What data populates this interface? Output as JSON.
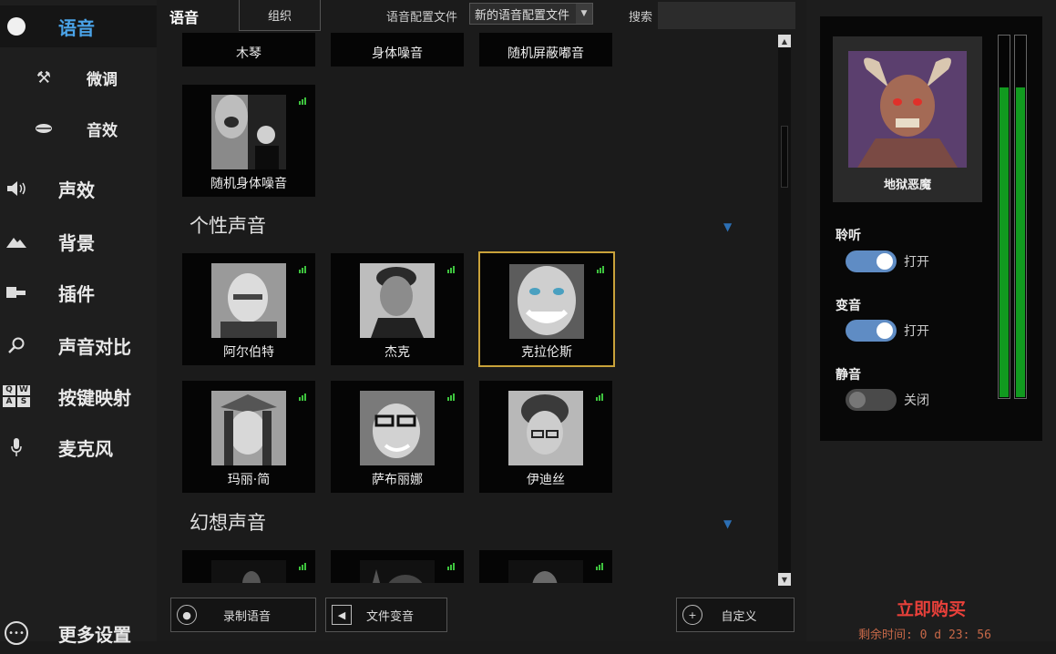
{
  "sidebar": {
    "items": [
      {
        "label": "语音",
        "icon": "logo-icon"
      },
      {
        "label": "微调",
        "icon": "tools-icon"
      },
      {
        "label": "音效",
        "icon": "lips-icon"
      },
      {
        "label": "声效",
        "icon": "speaker-icon"
      },
      {
        "label": "背景",
        "icon": "mountain-icon"
      },
      {
        "label": "插件",
        "icon": "plugin-icon"
      },
      {
        "label": "声音对比",
        "icon": "magnifier-icon"
      },
      {
        "label": "按键映射",
        "icon": "keyboard-icon"
      },
      {
        "label": "麦克风",
        "icon": "microphone-icon"
      },
      {
        "label": "更多设置",
        "icon": "more-icon"
      }
    ],
    "keyboard_keys": [
      "Q",
      "W",
      "A",
      "S"
    ]
  },
  "topbar": {
    "title": "语音",
    "org_button": "组织",
    "profile_label": "语音配置文件",
    "profile_value": "新的语音配置文件",
    "search_label": "搜索",
    "search_value": ""
  },
  "sections": [
    {
      "title": "",
      "cards": [
        "木琴",
        "身体噪音",
        "随机屏蔽嘟音",
        "随机身体噪音"
      ]
    },
    {
      "title": "个性声音",
      "cards": [
        "阿尔伯特",
        "杰克",
        "克拉伦斯",
        "玛丽·简",
        "萨布丽娜",
        "伊迪丝"
      ],
      "selected": "克拉伦斯"
    },
    {
      "title": "幻想声音",
      "cards": [
        "",
        "",
        ""
      ]
    }
  ],
  "bottom_buttons": {
    "record": "录制语音",
    "file": "文件变音",
    "custom": "自定义"
  },
  "right_panel": {
    "current_voice": "地狱恶魔",
    "listen": {
      "label": "聆听",
      "state": "打开",
      "on": true
    },
    "voice_change": {
      "label": "变音",
      "state": "打开",
      "on": true
    },
    "mute": {
      "label": "静音",
      "state": "关闭",
      "on": false
    },
    "vu_levels": [
      0.86,
      0.86
    ],
    "buy_now": "立即购买",
    "remaining": "剩余时间: 0 d 23: 56"
  },
  "colors": {
    "accent": "#4aa3e8",
    "selected_border": "#c9a23a",
    "signal": "#3ec43e",
    "vu_green": "#119a1f",
    "buy": "#e8403a",
    "toggle_on": "#5f8cc4"
  }
}
